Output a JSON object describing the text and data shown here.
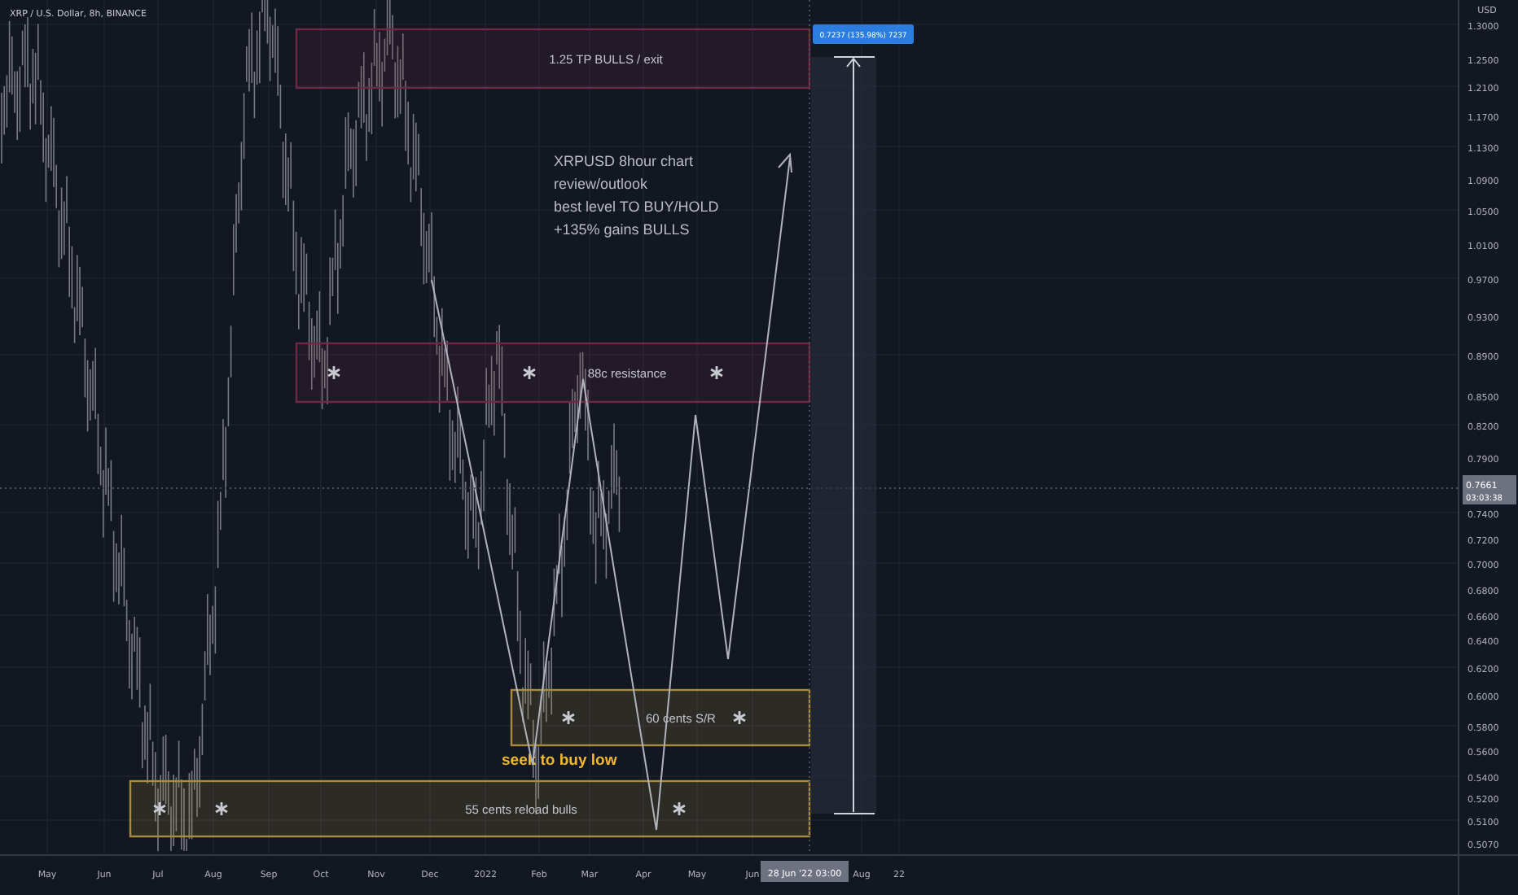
{
  "chart_header": {
    "symbol": "XRP / U.S. Dollar, 8h, BINANCE"
  },
  "price_axis": {
    "currency": "USD",
    "labels": [
      "1.3000",
      "1.2500",
      "1.2100",
      "1.1700",
      "1.1300",
      "1.0900",
      "1.0500",
      "1.0100",
      "0.9700",
      "0.9300",
      "0.8900",
      "0.8500",
      "0.8200",
      "0.7900",
      "0.7400",
      "0.7200",
      "0.7000",
      "0.6800",
      "0.6600",
      "0.6400",
      "0.6200",
      "0.6000",
      "0.5800",
      "0.5600",
      "0.5400",
      "0.5200",
      "0.5100",
      "0.5070"
    ],
    "current_price": {
      "price": "0.7661",
      "countdown": "03:03:38"
    }
  },
  "time_axis": {
    "labels": [
      "May",
      "Jun",
      "Jul",
      "Aug",
      "Sep",
      "Oct",
      "Nov",
      "Dec",
      "2022",
      "Feb",
      "Mar",
      "Apr",
      "May",
      "Jun",
      "Aug",
      "22"
    ],
    "crosshair_label": "28 Jun '22 03:00"
  },
  "zones": [
    {
      "text": "1.25 TP BULLS / exit",
      "color": "#6e2a45"
    },
    {
      "text": "88c resistance",
      "color": "#6e2a45"
    },
    {
      "text": "60 cents S/R",
      "color": "#a88b3c"
    },
    {
      "text": "55 cents reload bulls",
      "color": "#a88b3c"
    }
  ],
  "note": {
    "lines": [
      "XRPUSD 8hour chart",
      "review/outlook",
      "best level TO BUY/HOLD",
      "+135% gains BULLS"
    ]
  },
  "callout": {
    "text": "seek to buy low"
  },
  "measure": {
    "label": "0.7237 (135.98%) 7237"
  }
}
